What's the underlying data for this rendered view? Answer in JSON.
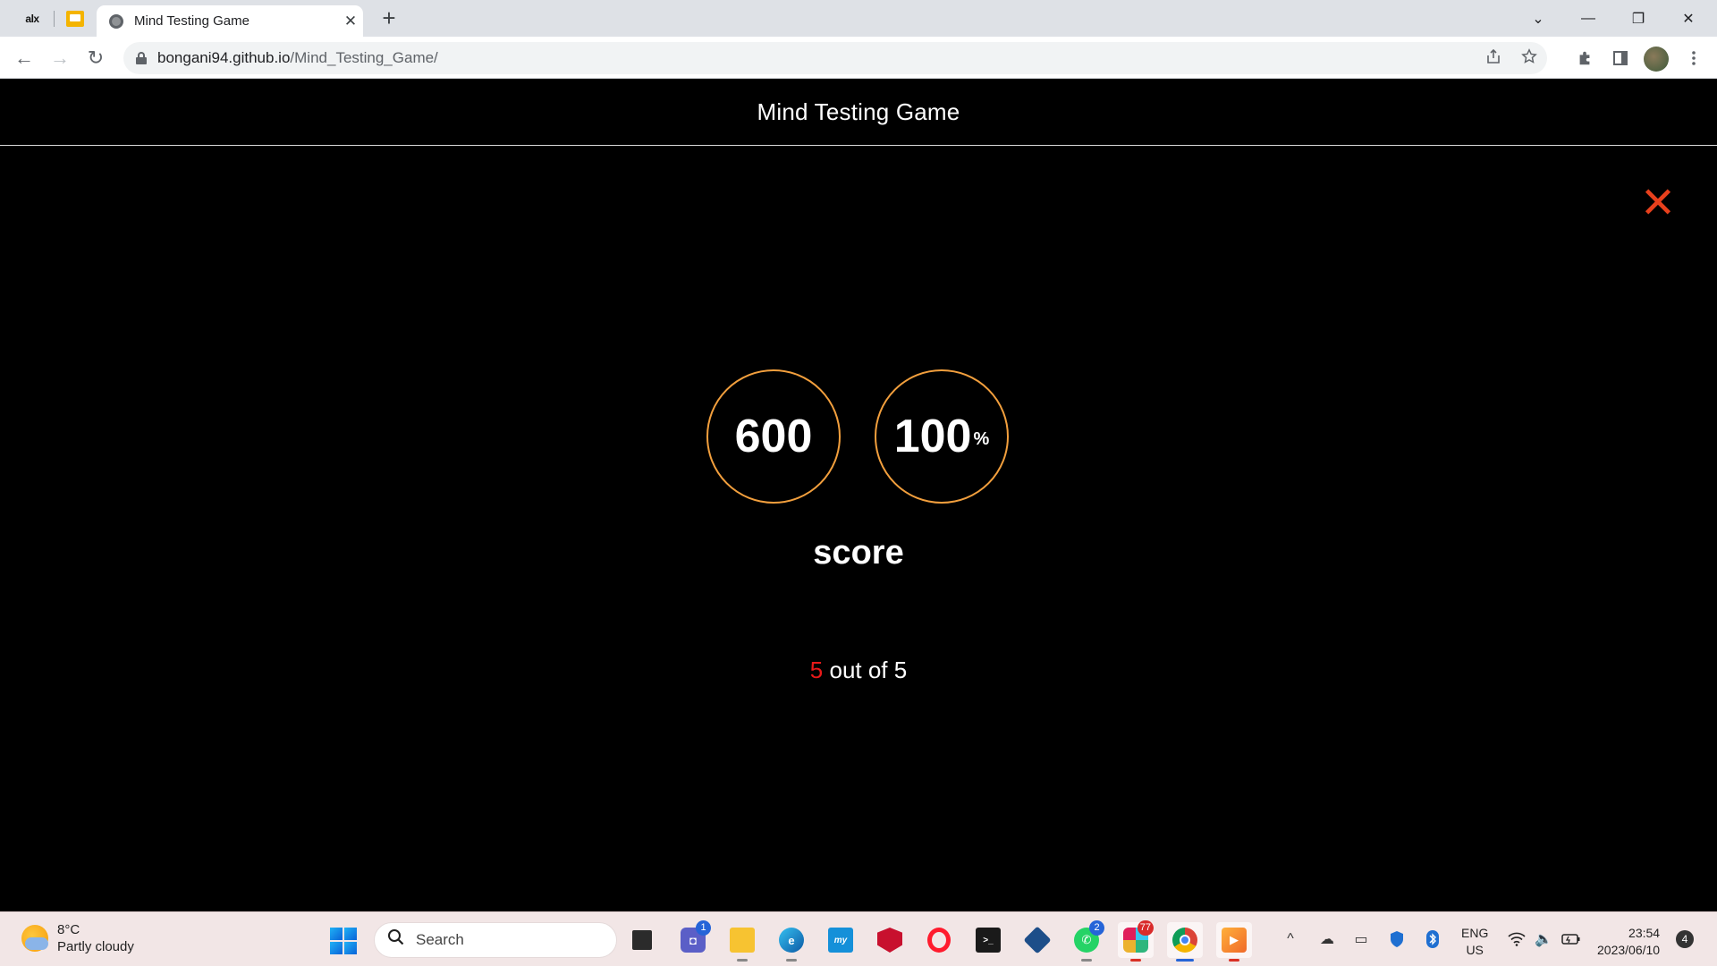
{
  "browser": {
    "pinned_tabs": [
      "alx"
    ],
    "active_tab": {
      "title": "Mind Testing Game",
      "close": "✕"
    },
    "new_tab": "+",
    "window_controls": [
      "⌄",
      "—",
      "❐",
      "✕"
    ],
    "nav": {
      "back": "←",
      "forward": "→",
      "reload": "↻"
    },
    "address": {
      "host": "bongani94.github.io",
      "path": "/Mind_Testing_Game/"
    },
    "omnibox_icons": [
      "share-icon",
      "star-icon"
    ],
    "toolbar_icons": [
      "extensions-icon",
      "side-panel-icon",
      "profile-avatar",
      "menu-icon"
    ]
  },
  "page": {
    "header_title": "Mind Testing Game",
    "close_symbol": "✕",
    "points": "600",
    "percent": "100",
    "percent_unit": "%",
    "score_label": "score",
    "result": {
      "correct": "5",
      "text": "out of 5"
    },
    "colors": {
      "circle_border": "#f29f3d",
      "close": "#e8401c",
      "correct_number": "#e81919"
    }
  },
  "taskbar": {
    "weather": {
      "temp": "8°C",
      "condition": "Partly cloudy"
    },
    "search_placeholder": "Search",
    "apps": [
      {
        "name": "task-view",
        "badge": ""
      },
      {
        "name": "teams-chat",
        "badge": "1"
      },
      {
        "name": "file-explorer",
        "badge": ""
      },
      {
        "name": "edge",
        "badge": ""
      },
      {
        "name": "myhp",
        "badge": ""
      },
      {
        "name": "mcafee",
        "badge": ""
      },
      {
        "name": "opera",
        "badge": ""
      },
      {
        "name": "terminal",
        "badge": ""
      },
      {
        "name": "virtualbox",
        "badge": ""
      },
      {
        "name": "whatsapp",
        "badge": "2"
      },
      {
        "name": "slack",
        "badge": "77"
      },
      {
        "name": "chrome",
        "badge": ""
      },
      {
        "name": "media-player",
        "badge": ""
      }
    ],
    "lang": {
      "line1": "ENG",
      "line2": "US"
    },
    "clock": {
      "time": "23:54",
      "date": "2023/06/10"
    },
    "notifications": "4"
  }
}
